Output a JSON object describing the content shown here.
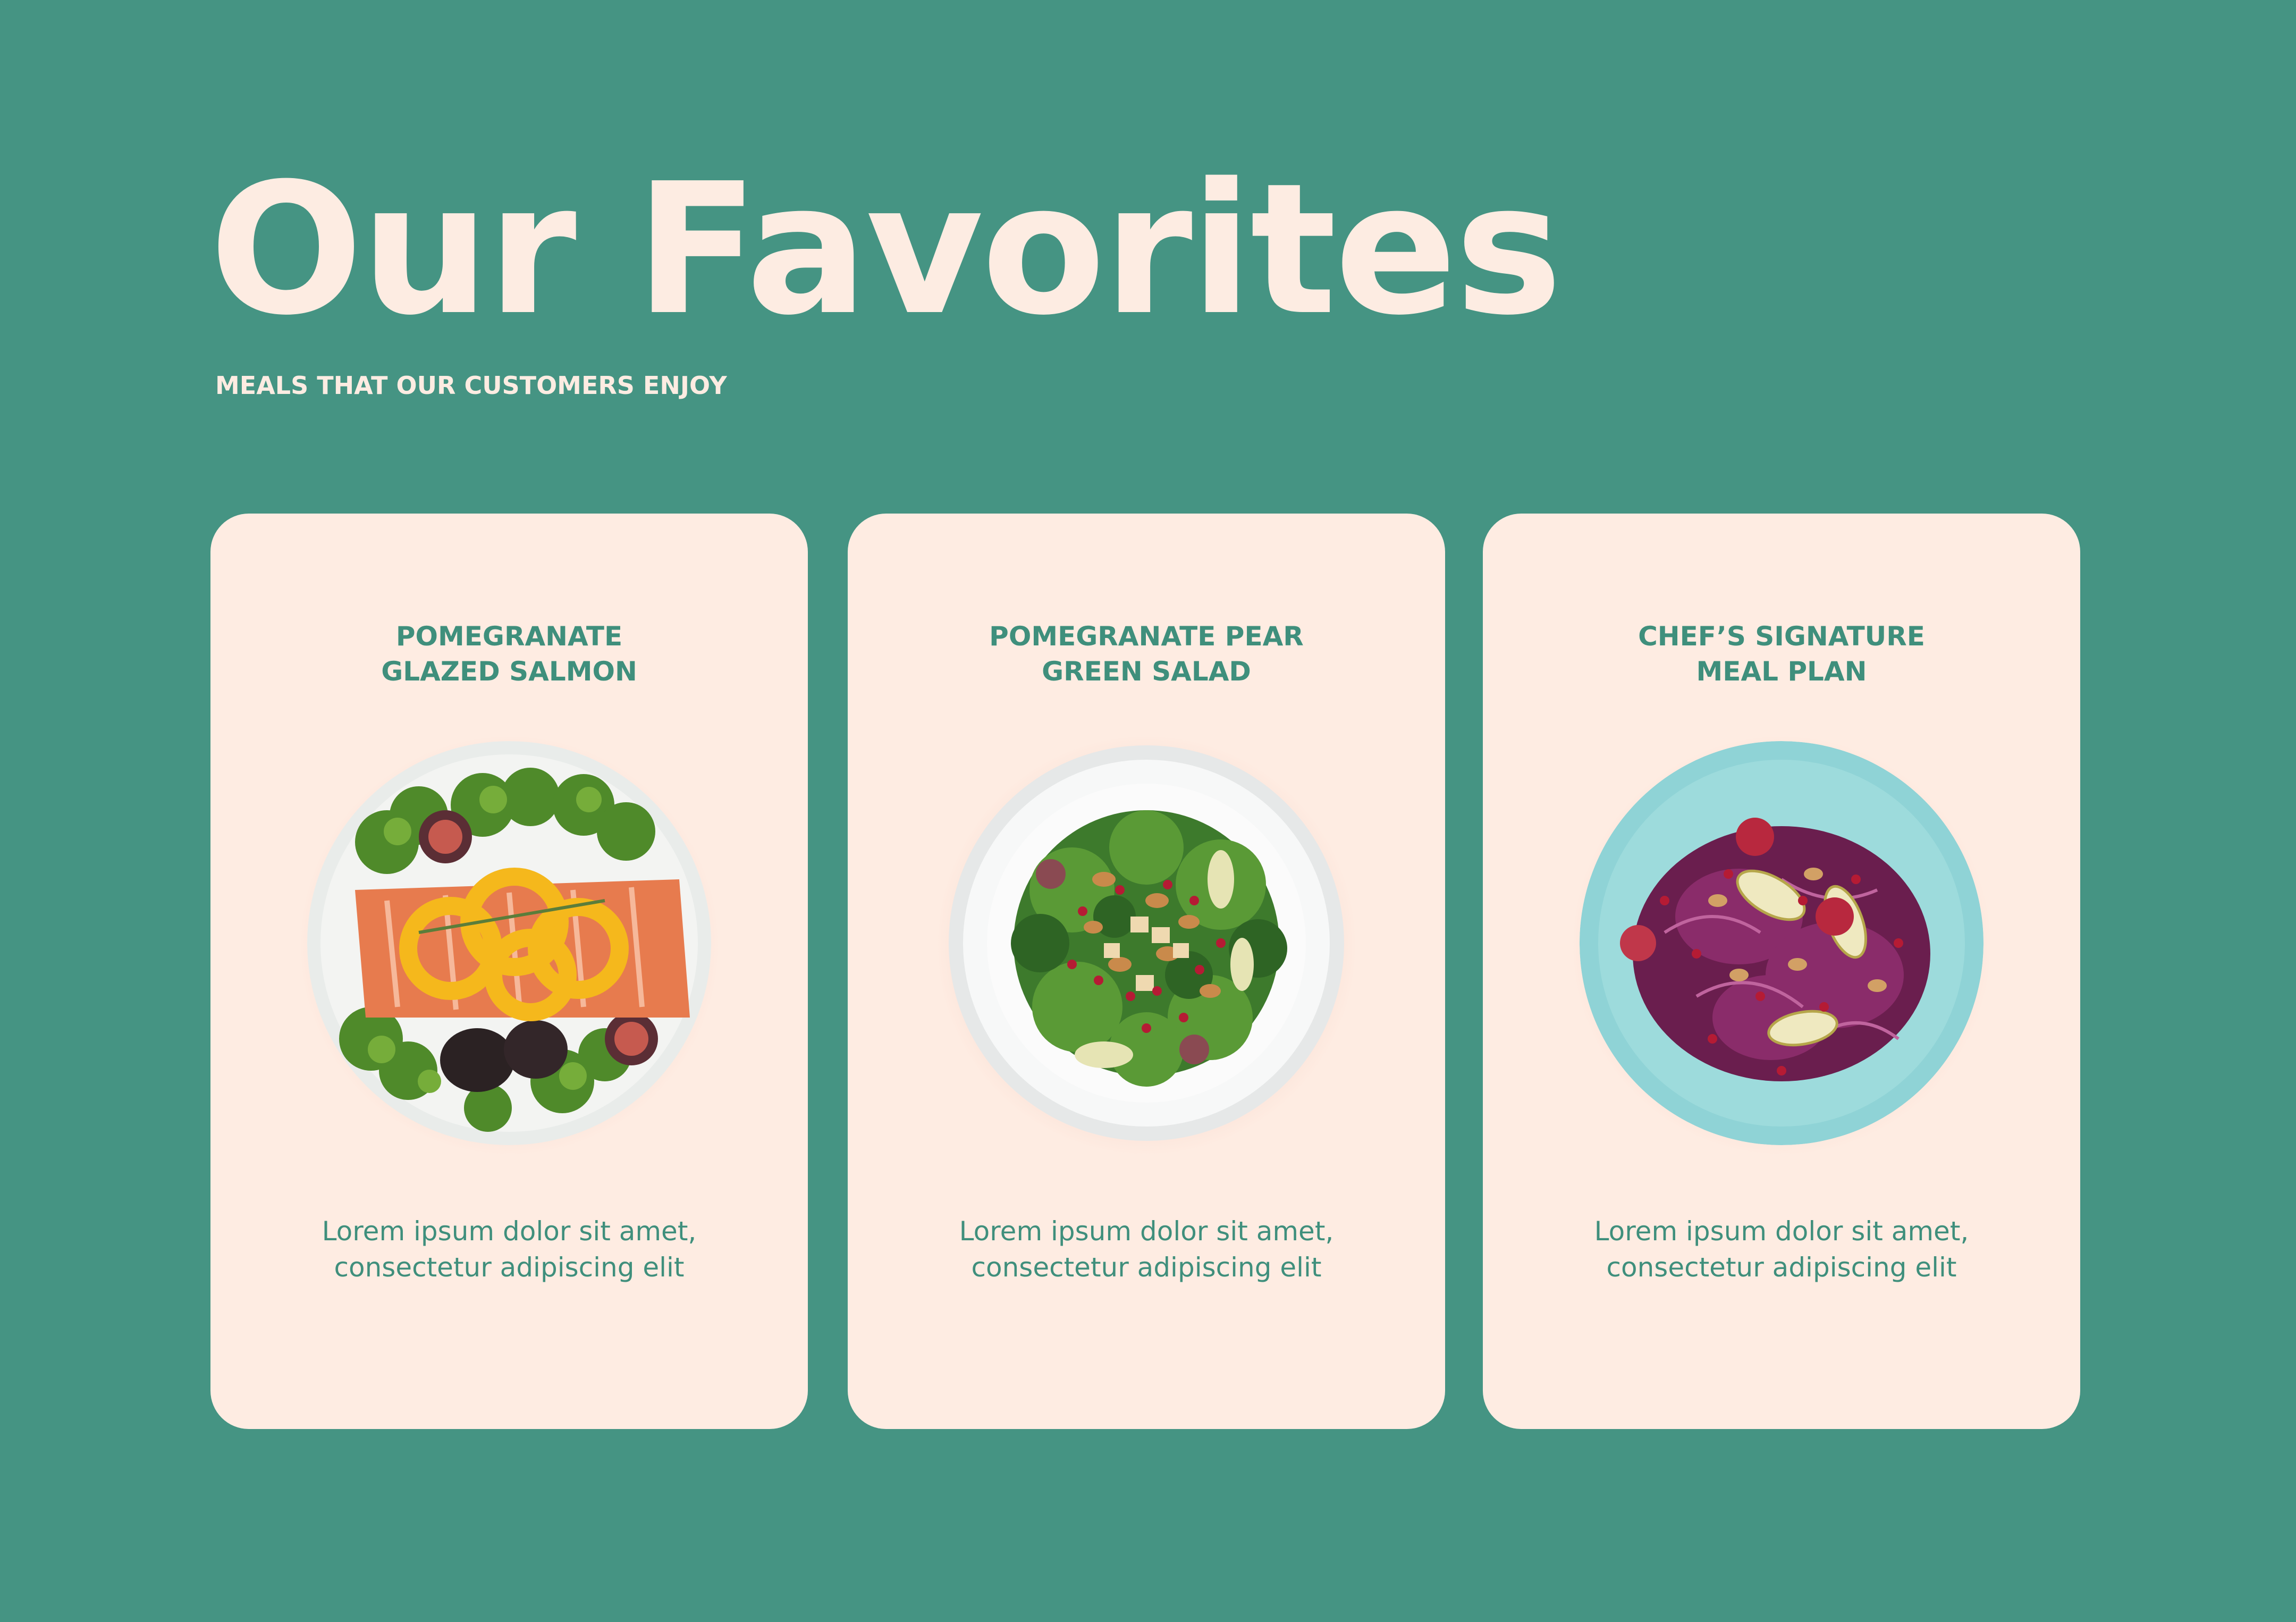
{
  "header": {
    "title": "Our Favorites",
    "subtitle": "MEALS THAT OUR CUSTOMERS ENJOY"
  },
  "cards": [
    {
      "title_line1": "POMEGRANATE",
      "title_line2": "GLAZED SALMON",
      "desc_line1": "Lorem ipsum dolor sit amet,",
      "desc_line2": "consectetur adipiscing elit",
      "image": "salmon-plate-image"
    },
    {
      "title_line1": "POMEGRANATE PEAR",
      "title_line2": "GREEN SALAD",
      "desc_line1": "Lorem ipsum dolor sit amet,",
      "desc_line2": "consectetur adipiscing elit",
      "image": "green-salad-plate-image"
    },
    {
      "title_line1": "CHEF’S SIGNATURE",
      "title_line2": "MEAL PLAN",
      "desc_line1": "Lorem ipsum dolor sit amet,",
      "desc_line2": "consectetur adipiscing elit",
      "image": "cabbage-salad-plate-image"
    }
  ],
  "colors": {
    "background": "#459483",
    "card": "#feece2",
    "heading": "#fdece2",
    "card_text": "#3f8f7c"
  }
}
